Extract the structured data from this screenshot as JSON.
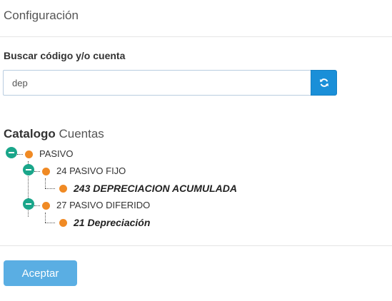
{
  "header": {
    "title": "Configuración"
  },
  "search": {
    "label": "Buscar código y/o cuenta",
    "value": "dep",
    "button_icon": "refresh-icon"
  },
  "tree": {
    "title_bold": "Catalogo",
    "title_light": "Cuentas",
    "nodes": [
      {
        "label": "PASIVO",
        "expanded": true
      },
      {
        "label": "24 PASIVO FIJO",
        "expanded": true
      },
      {
        "label": "243 DEPRECIACION ACUMULADA",
        "match": true
      },
      {
        "label": "27 PASIVO DIFERIDO",
        "expanded": true
      },
      {
        "label": "21 Depreciación",
        "match": true
      }
    ]
  },
  "footer": {
    "accept_label": "Aceptar"
  },
  "colors": {
    "toggle": "#1aa68a",
    "node_dot": "#f08a24",
    "search_button": "#1a8fd8",
    "accept_button": "#5aaee3"
  }
}
